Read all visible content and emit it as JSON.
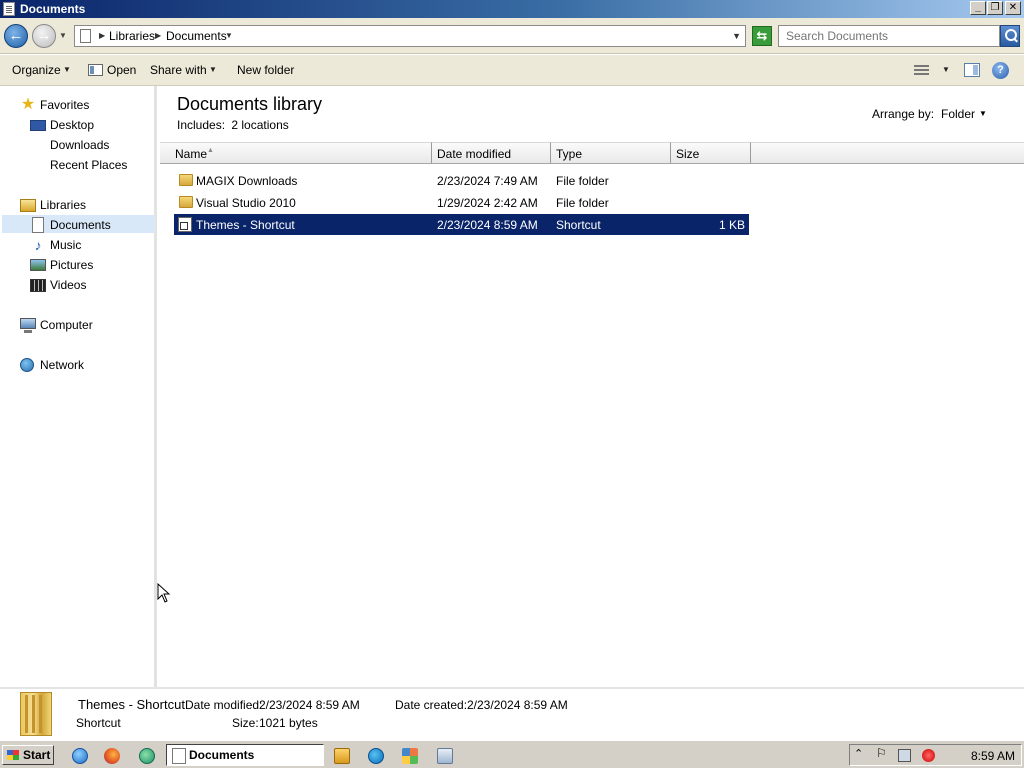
{
  "window": {
    "title": "Documents",
    "min_label": "_",
    "max_label": "❐",
    "close_label": "✕"
  },
  "nav": {
    "back_glyph": "←",
    "fwd_glyph": "→"
  },
  "address": {
    "crumbs": [
      "Libraries",
      "Documents"
    ],
    "refresh_glyph": "⇆"
  },
  "search": {
    "placeholder": "Search Documents"
  },
  "toolbar": {
    "organize": "Organize",
    "open": "Open",
    "share_with": "Share with",
    "new_folder": "New folder",
    "help": "?"
  },
  "sidebar": {
    "favorites": "Favorites",
    "desktop": "Desktop",
    "downloads": "Downloads",
    "recent_places": "Recent Places",
    "libraries": "Libraries",
    "documents": "Documents",
    "music": "Music",
    "pictures": "Pictures",
    "videos": "Videos",
    "computer": "Computer",
    "network": "Network"
  },
  "library": {
    "title": "Documents library",
    "includes_label": "Includes:",
    "locations_link": "2 locations",
    "arrange_label": "Arrange by:",
    "arrange_value": "Folder"
  },
  "columns": {
    "name": "Name",
    "date_modified": "Date modified",
    "type": "Type",
    "size": "Size"
  },
  "files": [
    {
      "name": "MAGIX Downloads",
      "date": "2/23/2024 7:49 AM",
      "type": "File folder",
      "size": "",
      "icon": "folder-icon"
    },
    {
      "name": "Visual Studio 2010",
      "date": "1/29/2024 2:42 AM",
      "type": "File folder",
      "size": "",
      "icon": "folder-icon"
    },
    {
      "name": "Themes - Shortcut",
      "date": "2/23/2024 8:59 AM",
      "type": "Shortcut",
      "size": "1 KB",
      "icon": "shortcut-icon",
      "selected": true
    }
  ],
  "details": {
    "name": "Themes - Shortcut",
    "type": "Shortcut",
    "date_modified_label": "Date modified:",
    "date_modified": "2/23/2024 8:59 AM",
    "date_created_label": "Date created:",
    "date_created": "2/23/2024 8:59 AM",
    "size_label": "Size:",
    "size": "1021 bytes"
  },
  "taskbar": {
    "start": "Start",
    "active_window": "Documents",
    "clock": "8:59 AM"
  },
  "colors": {
    "selection": "#0a246a",
    "title_gradient_start": "#0a246a",
    "title_gradient_end": "#a6caf0",
    "chrome": "#ece9d8"
  }
}
